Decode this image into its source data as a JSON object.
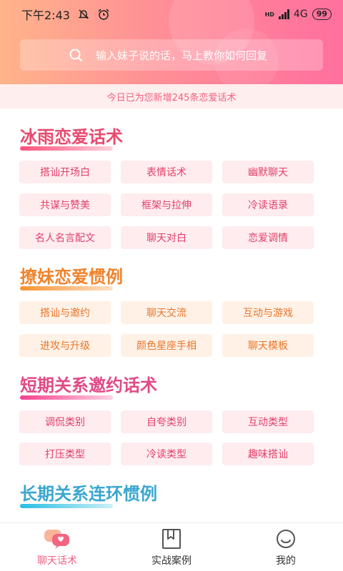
{
  "status_bar": {
    "time": "下午2:43",
    "network": "4G",
    "battery": "99",
    "icons": [
      "mute-bell-icon",
      "alarm-icon",
      "hd-icon",
      "signal-icon",
      "battery-icon"
    ]
  },
  "search": {
    "placeholder": "输入妹子说的话，马上教你如何回复",
    "icon": "search-icon"
  },
  "notice": "今日已为您新增245条恋爱话术",
  "sections": [
    {
      "title": "冰雨恋爱话术",
      "color": "#e84a6e",
      "underline": [
        "#ff4f7a",
        "#ffd1db"
      ],
      "items": [
        "搭讪开场白",
        "表情话术",
        "幽默聊天",
        "共谋与赞美",
        "框架与拉伸",
        "冷读语录",
        "名人名言配文",
        "聊天对白",
        "恋爱调情"
      ]
    },
    {
      "title": "撩妹恋爱惯例",
      "color": "#f0832c",
      "underline": [
        "#f8922f",
        "#ffe0c6"
      ],
      "items": [
        "搭讪与邀约",
        "聊天交流",
        "互动与游戏",
        "进攻与升级",
        "颜色星座手相",
        "聊天模板"
      ]
    },
    {
      "title": "短期关系邀约话术",
      "color": "#e04a86",
      "underline": [
        "#f7408f",
        "#ffd2e4"
      ],
      "items": [
        "调侃类别",
        "自夸类别",
        "互动类型",
        "打压类型",
        "冷读类型",
        "趣味搭讪"
      ]
    },
    {
      "title": "长期关系连环惯例",
      "color": "#3aa6cf",
      "underline": [
        "#27bfe3",
        "#cdeff8"
      ],
      "items": []
    }
  ],
  "tabbar": {
    "tabs": [
      {
        "label": "聊天话术",
        "icon": "chat-bubbles-icon",
        "active": true
      },
      {
        "label": "实战案例",
        "icon": "bookmark-book-icon",
        "active": false
      },
      {
        "label": "我的",
        "icon": "smiley-face-icon",
        "active": false
      }
    ]
  }
}
